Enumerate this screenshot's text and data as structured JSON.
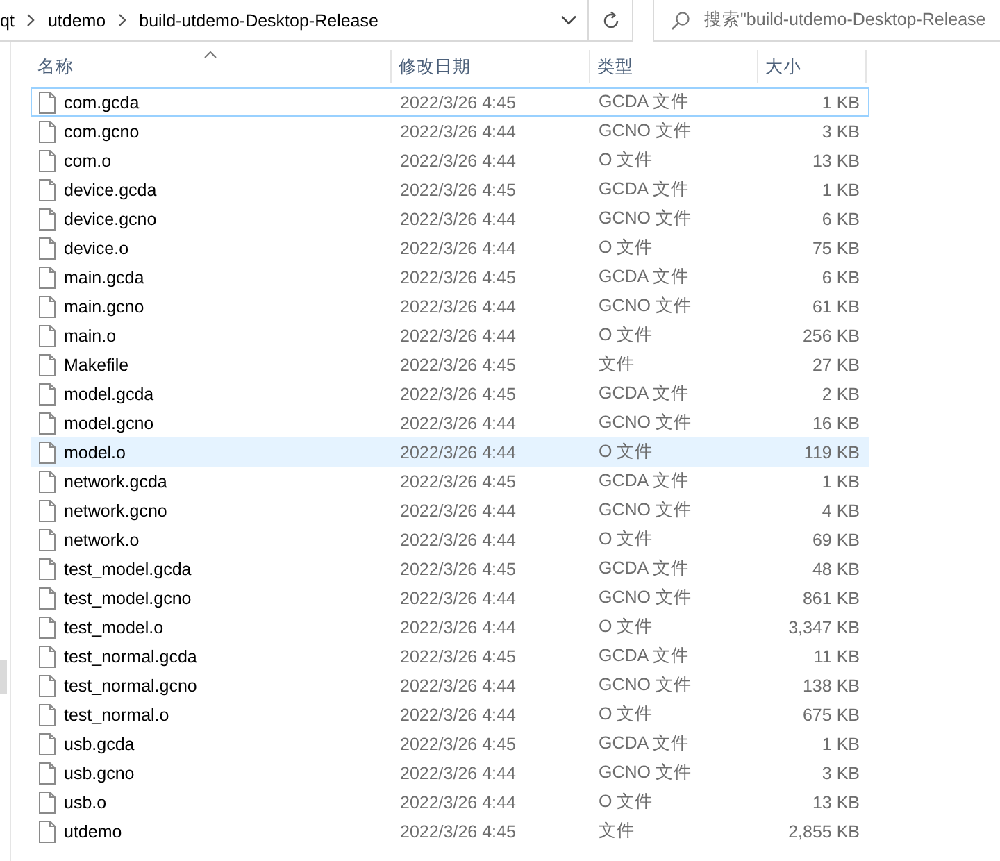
{
  "address_bar": {
    "breadcrumbs": [
      "qt",
      "utdemo",
      "build-utdemo-Desktop-Release"
    ]
  },
  "search": {
    "placeholder": "搜索\"build-utdemo-Desktop-Release"
  },
  "columns": [
    {
      "label": "名称",
      "sorted": true
    },
    {
      "label": "修改日期",
      "sorted": false
    },
    {
      "label": "类型",
      "sorted": false
    },
    {
      "label": "大小",
      "sorted": false
    }
  ],
  "rows": [
    {
      "name": "com.gcda",
      "date": "2022/3/26 4:45",
      "type": "GCDA 文件",
      "size": "1 KB",
      "selected": false,
      "focused": true
    },
    {
      "name": "com.gcno",
      "date": "2022/3/26 4:44",
      "type": "GCNO 文件",
      "size": "3 KB",
      "selected": false,
      "focused": false
    },
    {
      "name": "com.o",
      "date": "2022/3/26 4:44",
      "type": "O 文件",
      "size": "13 KB",
      "selected": false,
      "focused": false
    },
    {
      "name": "device.gcda",
      "date": "2022/3/26 4:45",
      "type": "GCDA 文件",
      "size": "1 KB",
      "selected": false,
      "focused": false
    },
    {
      "name": "device.gcno",
      "date": "2022/3/26 4:44",
      "type": "GCNO 文件",
      "size": "6 KB",
      "selected": false,
      "focused": false
    },
    {
      "name": "device.o",
      "date": "2022/3/26 4:44",
      "type": "O 文件",
      "size": "75 KB",
      "selected": false,
      "focused": false
    },
    {
      "name": "main.gcda",
      "date": "2022/3/26 4:45",
      "type": "GCDA 文件",
      "size": "6 KB",
      "selected": false,
      "focused": false
    },
    {
      "name": "main.gcno",
      "date": "2022/3/26 4:44",
      "type": "GCNO 文件",
      "size": "61 KB",
      "selected": false,
      "focused": false
    },
    {
      "name": "main.o",
      "date": "2022/3/26 4:44",
      "type": "O 文件",
      "size": "256 KB",
      "selected": false,
      "focused": false
    },
    {
      "name": "Makefile",
      "date": "2022/3/26 4:45",
      "type": "文件",
      "size": "27 KB",
      "selected": false,
      "focused": false
    },
    {
      "name": "model.gcda",
      "date": "2022/3/26 4:45",
      "type": "GCDA 文件",
      "size": "2 KB",
      "selected": false,
      "focused": false
    },
    {
      "name": "model.gcno",
      "date": "2022/3/26 4:44",
      "type": "GCNO 文件",
      "size": "16 KB",
      "selected": false,
      "focused": false
    },
    {
      "name": "model.o",
      "date": "2022/3/26 4:44",
      "type": "O 文件",
      "size": "119 KB",
      "selected": true,
      "focused": false
    },
    {
      "name": "network.gcda",
      "date": "2022/3/26 4:45",
      "type": "GCDA 文件",
      "size": "1 KB",
      "selected": false,
      "focused": false
    },
    {
      "name": "network.gcno",
      "date": "2022/3/26 4:44",
      "type": "GCNO 文件",
      "size": "4 KB",
      "selected": false,
      "focused": false
    },
    {
      "name": "network.o",
      "date": "2022/3/26 4:44",
      "type": "O 文件",
      "size": "69 KB",
      "selected": false,
      "focused": false
    },
    {
      "name": "test_model.gcda",
      "date": "2022/3/26 4:45",
      "type": "GCDA 文件",
      "size": "48 KB",
      "selected": false,
      "focused": false
    },
    {
      "name": "test_model.gcno",
      "date": "2022/3/26 4:44",
      "type": "GCNO 文件",
      "size": "861 KB",
      "selected": false,
      "focused": false
    },
    {
      "name": "test_model.o",
      "date": "2022/3/26 4:44",
      "type": "O 文件",
      "size": "3,347 KB",
      "selected": false,
      "focused": false
    },
    {
      "name": "test_normal.gcda",
      "date": "2022/3/26 4:45",
      "type": "GCDA 文件",
      "size": "11 KB",
      "selected": false,
      "focused": false
    },
    {
      "name": "test_normal.gcno",
      "date": "2022/3/26 4:44",
      "type": "GCNO 文件",
      "size": "138 KB",
      "selected": false,
      "focused": false
    },
    {
      "name": "test_normal.o",
      "date": "2022/3/26 4:44",
      "type": "O 文件",
      "size": "675 KB",
      "selected": false,
      "focused": false
    },
    {
      "name": "usb.gcda",
      "date": "2022/3/26 4:45",
      "type": "GCDA 文件",
      "size": "1 KB",
      "selected": false,
      "focused": false
    },
    {
      "name": "usb.gcno",
      "date": "2022/3/26 4:44",
      "type": "GCNO 文件",
      "size": "3 KB",
      "selected": false,
      "focused": false
    },
    {
      "name": "usb.o",
      "date": "2022/3/26 4:44",
      "type": "O 文件",
      "size": "13 KB",
      "selected": false,
      "focused": false
    },
    {
      "name": "utdemo",
      "date": "2022/3/26 4:45",
      "type": "文件",
      "size": "2,855 KB",
      "selected": false,
      "focused": false
    }
  ]
}
